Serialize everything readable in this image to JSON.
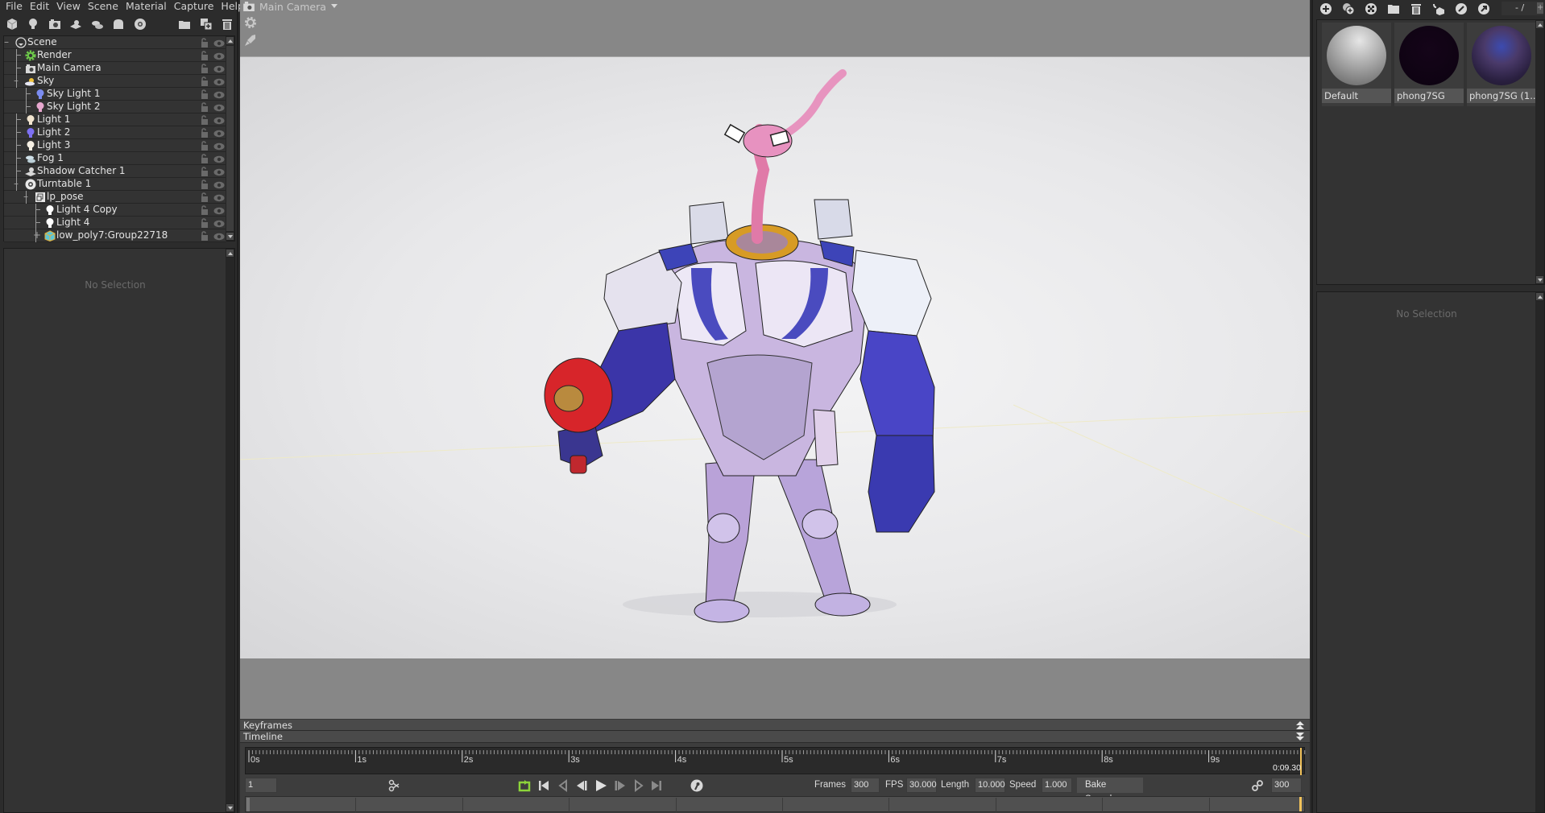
{
  "menu": [
    "File",
    "Edit",
    "View",
    "Scene",
    "Material",
    "Capture",
    "Help"
  ],
  "left_toolbar": [
    {
      "icon": "cube-icon"
    },
    {
      "icon": "light-bulb-icon"
    },
    {
      "icon": "camera-icon"
    },
    {
      "icon": "shadow-catcher-icon"
    },
    {
      "icon": "fog-icon"
    },
    {
      "icon": "bread-icon"
    },
    {
      "icon": "turntable-icon"
    },
    {
      "icon": "folder-icon"
    },
    {
      "icon": "duplicate-icon"
    },
    {
      "icon": "trash-icon"
    }
  ],
  "scene_tree": [
    {
      "label": "Scene",
      "depth": 0,
      "icon": "scene-icon",
      "expander": "-"
    },
    {
      "label": "Render",
      "depth": 1,
      "icon": "gear-icon"
    },
    {
      "label": "Main Camera",
      "depth": 1,
      "icon": "camera-icon"
    },
    {
      "label": "Sky",
      "depth": 1,
      "icon": "sky-icon",
      "expander": "-"
    },
    {
      "label": "Sky Light 1",
      "depth": 2,
      "icon": "light-bulb-icon",
      "color": "#7b8cf0"
    },
    {
      "label": "Sky Light 2",
      "depth": 2,
      "icon": "light-bulb-icon",
      "color": "#e7a8cf"
    },
    {
      "label": "Light 1",
      "depth": 1,
      "icon": "light-bulb-icon",
      "color": "#f1e4cf"
    },
    {
      "label": "Light 2",
      "depth": 1,
      "icon": "light-bulb-icon",
      "color": "#7d70f2"
    },
    {
      "label": "Light 3",
      "depth": 1,
      "icon": "light-bulb-icon",
      "color": "#f5efe3"
    },
    {
      "label": "Fog 1",
      "depth": 1,
      "icon": "fog-icon"
    },
    {
      "label": "Shadow Catcher 1",
      "depth": 1,
      "icon": "shadow-catcher-icon"
    },
    {
      "label": "Turntable 1",
      "depth": 1,
      "icon": "turntable-icon",
      "expander": "-"
    },
    {
      "label": "lp_pose",
      "depth": 2,
      "icon": "group-icon",
      "expander": "-"
    },
    {
      "label": "Light 4 Copy",
      "depth": 3,
      "icon": "light-bulb-icon",
      "color": "#ffffff"
    },
    {
      "label": "Light 4",
      "depth": 3,
      "icon": "light-bulb-icon",
      "color": "#ffffff"
    },
    {
      "label": "low_poly7:Group22718",
      "depth": 3,
      "icon": "mesh-icon",
      "expander": "+"
    }
  ],
  "left_properties": {
    "empty_text": "No Selection"
  },
  "viewport": {
    "camera_label": "Main Camera"
  },
  "timeline": {
    "keyframes_label": "Keyframes",
    "timeline_label": "Timeline",
    "ticks": [
      "0s",
      "1s",
      "2s",
      "3s",
      "4s",
      "5s",
      "6s",
      "7s",
      "8s",
      "9s"
    ],
    "current_time": "0:09.30",
    "current_frame": "1",
    "frames_label": "Frames",
    "frames": "300",
    "fps_label": "FPS",
    "fps": "30.000",
    "length_label": "Length",
    "length": "10.000",
    "speed_label": "Speed",
    "speed": "1.000",
    "bake_speed_label": "Bake Speed",
    "end_frame": "300",
    "loop_color": "#8cd43a",
    "playhead_color": "#f1c25a"
  },
  "right_toolbar": [
    {
      "icon": "add-material-icon"
    },
    {
      "icon": "duplicate-material-icon"
    },
    {
      "icon": "checker-icon"
    },
    {
      "icon": "folder-icon"
    },
    {
      "icon": "trash-icon"
    },
    {
      "icon": "apply-to-mesh-icon"
    },
    {
      "icon": "pick-material-icon"
    },
    {
      "icon": "export-icon"
    }
  ],
  "material_page": {
    "text": "- /",
    "plus": "+"
  },
  "materials": [
    {
      "name": "Default"
    },
    {
      "name": "phong7SG"
    },
    {
      "name": "phong7SG (1..."
    }
  ],
  "right_properties": {
    "empty_text": "No Selection"
  }
}
